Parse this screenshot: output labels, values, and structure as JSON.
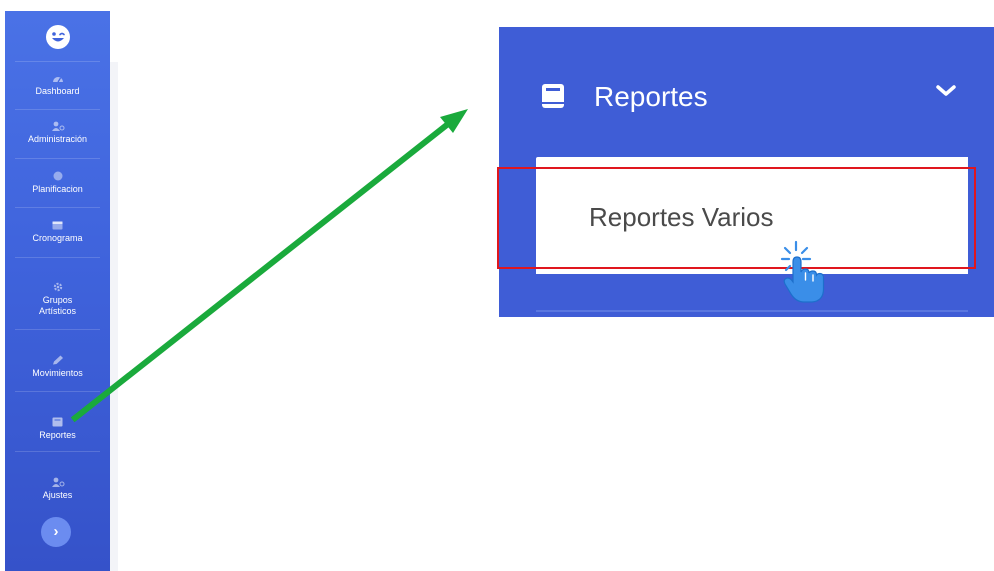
{
  "sidebar": {
    "logo_icon": "smile-wink-icon",
    "items": [
      {
        "label": "Dashboard",
        "icon": "gauge-icon"
      },
      {
        "label": "Administración",
        "icon": "users-cog-icon"
      },
      {
        "label": "Planificacion",
        "icon": "circle-icon"
      },
      {
        "label": "Cronograma",
        "icon": "calendar-icon"
      },
      {
        "label_line1": "Grupos",
        "label_line2": "Artísticos",
        "icon": "gear-icon"
      },
      {
        "label": "Movimientos",
        "icon": "pencil-icon"
      },
      {
        "label": "Reportes",
        "icon": "book-icon"
      },
      {
        "label": "Ajustes",
        "icon": "users-cog-icon"
      }
    ],
    "toggle_glyph": "›"
  },
  "zoom_panel": {
    "menu_title": "Reportes",
    "menu_icon": "book-icon",
    "chevron": "chevron-down-icon",
    "submenu_item": "Reportes Varios",
    "cursor_icon": "hand-pointer-click-icon"
  },
  "colors": {
    "sidebar_top": "#4a72e6",
    "sidebar_bottom": "#3552c9",
    "zoom_bg": "#3f5dd6",
    "highlight": "#e0161e",
    "arrow": "#1aaa3c"
  }
}
